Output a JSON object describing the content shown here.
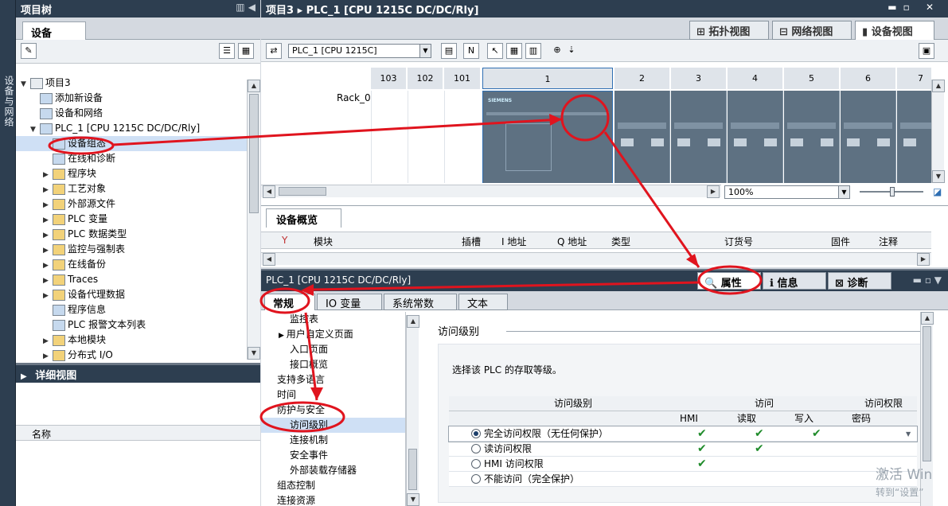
{
  "side_tab": {
    "label": "设备与网络"
  },
  "project_tree": {
    "title": "项目树",
    "tab": "设备",
    "items": [
      {
        "label": "项目3",
        "icon": "project-icon"
      },
      {
        "label": "添加新设备",
        "icon": "add-device-icon"
      },
      {
        "label": "设备和网络",
        "icon": "network-icon"
      },
      {
        "label": "PLC_1 [CPU 1215C DC/DC/Rly]",
        "icon": "plc-icon"
      },
      {
        "label": "设备组态",
        "icon": "device-config-icon"
      },
      {
        "label": "在线和诊断",
        "icon": "diagnostics-icon"
      },
      {
        "label": "程序块",
        "icon": "folder-icon"
      },
      {
        "label": "工艺对象",
        "icon": "folder-icon"
      },
      {
        "label": "外部源文件",
        "icon": "folder-icon"
      },
      {
        "label": "PLC 变量",
        "icon": "folder-icon"
      },
      {
        "label": "PLC 数据类型",
        "icon": "folder-icon"
      },
      {
        "label": "监控与强制表",
        "icon": "folder-icon"
      },
      {
        "label": "在线备份",
        "icon": "folder-icon"
      },
      {
        "label": "Traces",
        "icon": "folder-icon"
      },
      {
        "label": "设备代理数据",
        "icon": "folder-icon"
      },
      {
        "label": "程序信息",
        "icon": "info-icon"
      },
      {
        "label": "PLC 报警文本列表",
        "icon": "list-icon"
      },
      {
        "label": "本地模块",
        "icon": "folder-icon"
      },
      {
        "label": "分布式 I/O",
        "icon": "folder-icon"
      }
    ]
  },
  "detail_view": {
    "title": "详细视图",
    "column": "名称"
  },
  "editor": {
    "title": "项目3 ▸ PLC_1 [CPU 1215C DC/DC/Rly]",
    "views": [
      "拓扑视图",
      "网络视图",
      "设备视图"
    ],
    "device_select": "PLC_1 [CPU 1215C]",
    "rack_label": "Rack_0",
    "slots": [
      "103",
      "102",
      "101",
      "1",
      "2",
      "3",
      "4",
      "5",
      "6",
      "7"
    ],
    "cpu_brand": "SIEMENS",
    "zoom": "100%"
  },
  "overview": {
    "tab": "设备概览",
    "columns": [
      "模块",
      "插槽",
      "I 地址",
      "Q 地址",
      "类型",
      "订货号",
      "固件",
      "注释"
    ]
  },
  "inspector": {
    "title": "PLC_1 [CPU 1215C DC/DC/Rly]",
    "tabs": [
      "属性",
      "信息",
      "诊断"
    ],
    "prop_tabs": [
      "常规",
      "IO 变量",
      "系统常数",
      "文本"
    ],
    "nav": [
      {
        "label": "监控表",
        "level": "sub"
      },
      {
        "label": "用户自定义页面",
        "level": "sub-exp"
      },
      {
        "label": "入口页面",
        "level": "sub"
      },
      {
        "label": "接口概览",
        "level": "sub"
      },
      {
        "label": "支持多语言",
        "level": "top"
      },
      {
        "label": "时间",
        "level": "top"
      },
      {
        "label": "防护与安全",
        "level": "top"
      },
      {
        "label": "访问级别",
        "level": "sub"
      },
      {
        "label": "连接机制",
        "level": "sub"
      },
      {
        "label": "安全事件",
        "level": "sub"
      },
      {
        "label": "外部装载存储器",
        "level": "sub"
      },
      {
        "label": "组态控制",
        "level": "top"
      },
      {
        "label": "连接资源",
        "level": "top"
      }
    ],
    "section_title": "访问级别",
    "instruction": "选择该 PLC 的存取等级。",
    "grid": {
      "h1": {
        "level": "访问级别",
        "access": "访问",
        "perm": "访问权限"
      },
      "h2": {
        "hmi": "HMI",
        "read": "读取",
        "write": "写入",
        "password": "密码"
      },
      "rows": [
        {
          "label": "完全访问权限（无任何保护）",
          "hmi": true,
          "read": true,
          "write": true,
          "selected": true
        },
        {
          "label": "读访问权限",
          "hmi": true,
          "read": true,
          "write": false,
          "selected": false
        },
        {
          "label": "HMI 访问权限",
          "hmi": true,
          "read": false,
          "write": false,
          "selected": false
        },
        {
          "label": "不能访问（完全保护）",
          "hmi": false,
          "read": false,
          "write": false,
          "selected": false
        }
      ]
    }
  },
  "watermark": {
    "line1": "激活 Win",
    "line2": "转到“设置”"
  },
  "colors": {
    "title_bar": "#2d3e50",
    "annotation": "#e0141e",
    "selection": "#cfe0f5",
    "check": "#1f8b2a"
  }
}
